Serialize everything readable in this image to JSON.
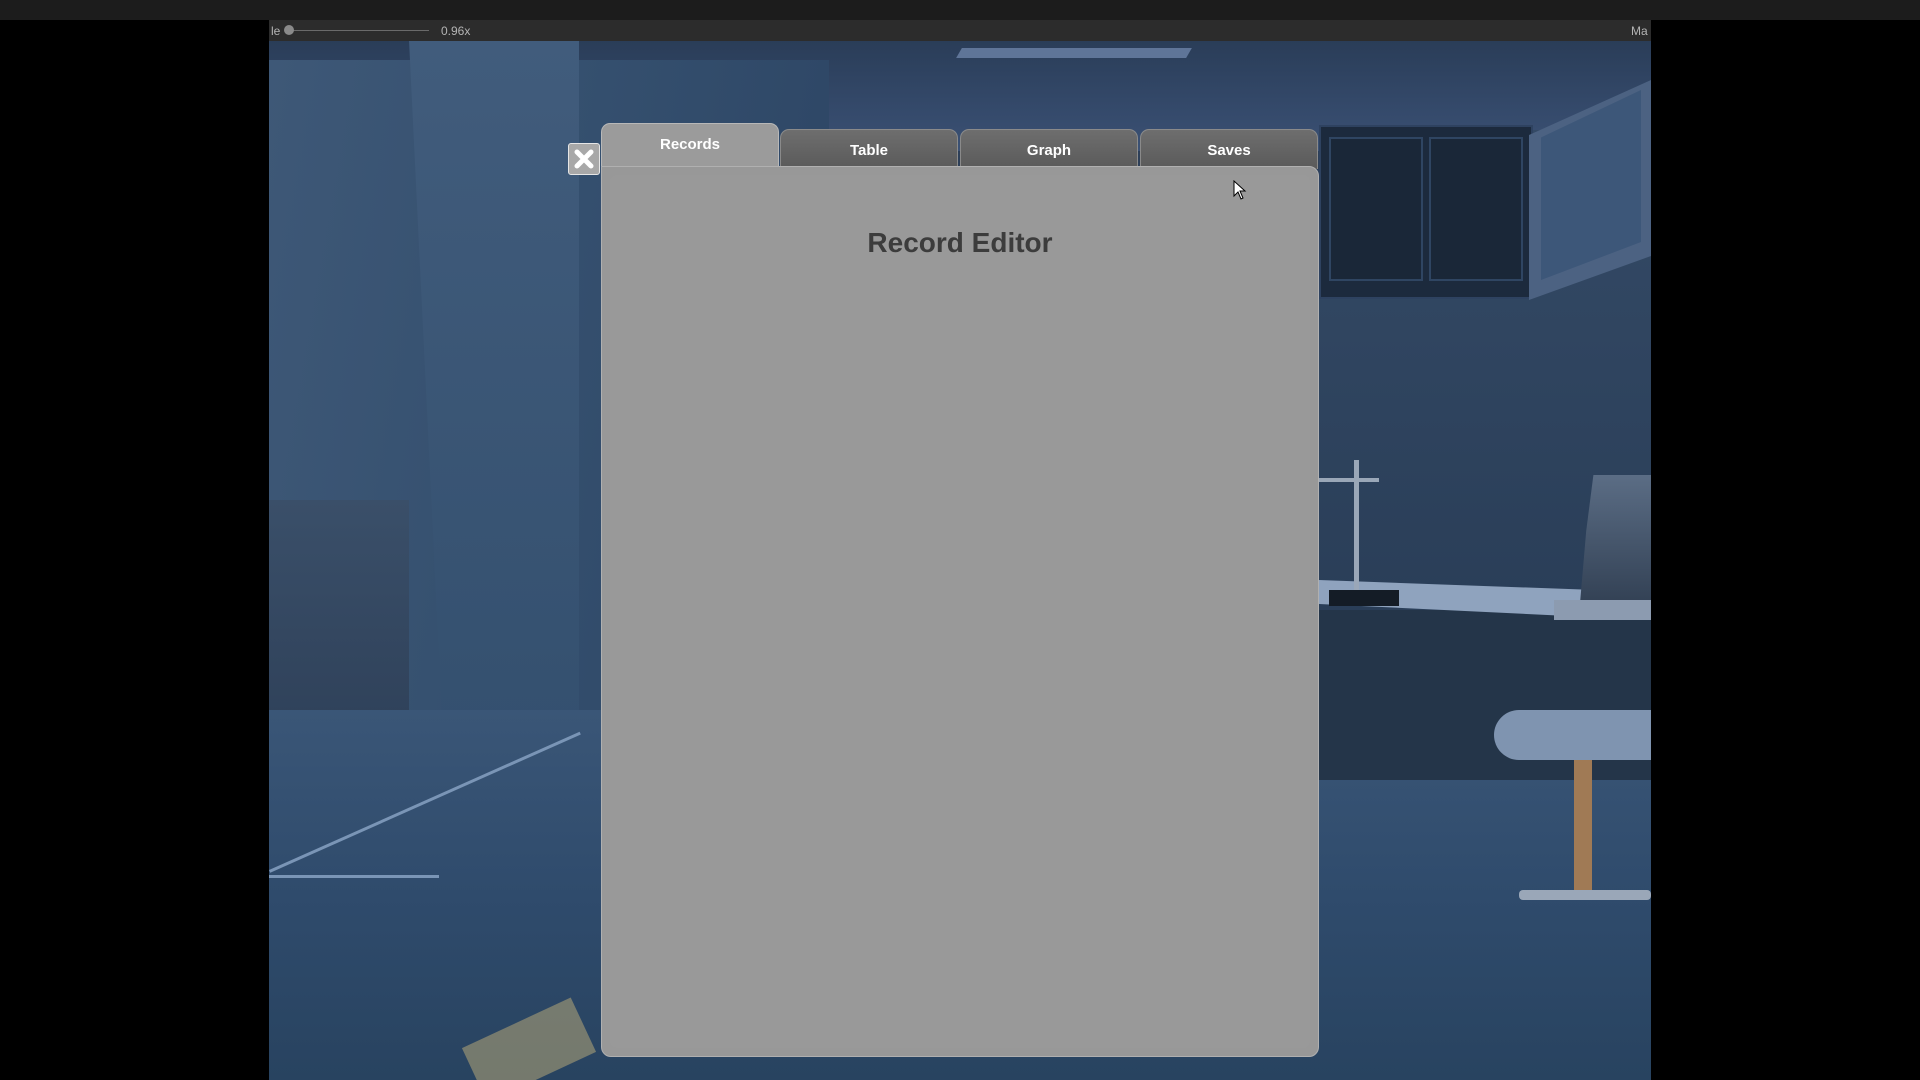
{
  "toolbar": {
    "left_label": "le",
    "scale_value": "0.96x",
    "right_label": "Ma"
  },
  "tabs": [
    {
      "label": "Records",
      "active": true
    },
    {
      "label": "Table",
      "active": false
    },
    {
      "label": "Graph",
      "active": false
    },
    {
      "label": "Saves",
      "active": false
    }
  ],
  "panel": {
    "title": "Record Editor"
  },
  "icons": {
    "close": "close-icon",
    "cursor": "mouse-cursor-icon"
  },
  "colors": {
    "panel_bg": "#999999",
    "tab_bg": "#636363",
    "active_tab_bg": "#9b9b9b",
    "title_text": "#3c3c3c",
    "scene_bg": "#2d3f58"
  }
}
